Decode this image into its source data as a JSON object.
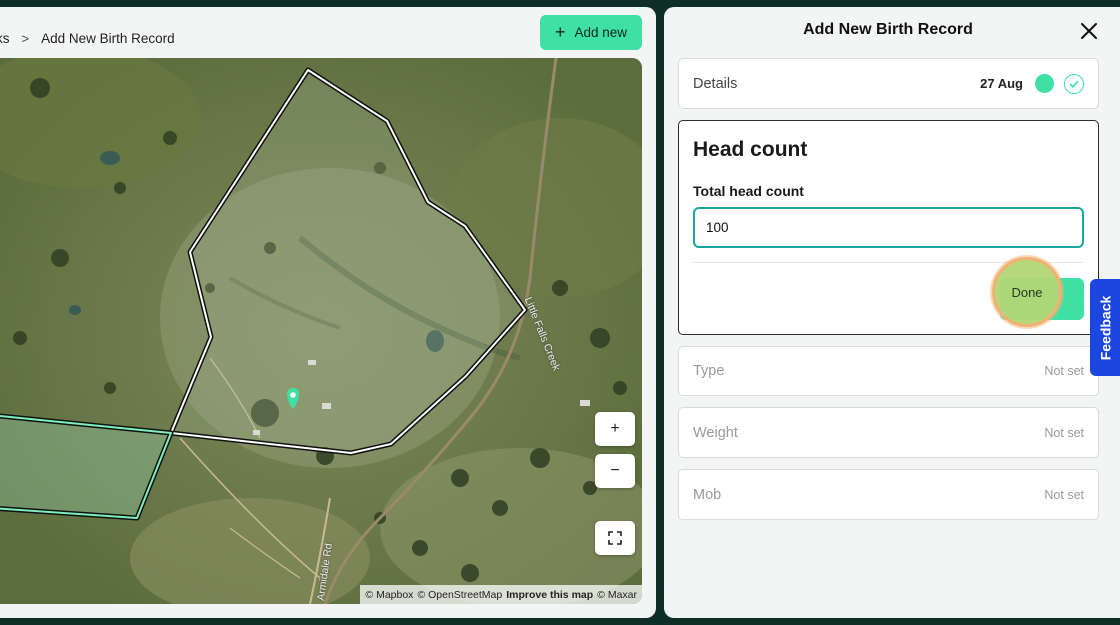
{
  "breadcrumb": {
    "prev_label": "ks",
    "separator": ">",
    "current_label": "Add New Birth Record"
  },
  "toolbar": {
    "add_new_label": "Add new",
    "add_new_icon": "plus-icon"
  },
  "map": {
    "zoom_in_label": "+",
    "zoom_out_label": "−",
    "fullscreen_icon": "expand-icon",
    "marker_icon": "location-pin-icon",
    "road_labels": [
      "Little Falls Creek",
      "Armidale Rd"
    ],
    "attribution": {
      "mapbox": "© Mapbox",
      "osm": "© OpenStreetMap",
      "improve": "Improve this map",
      "maxar": "© Maxar"
    }
  },
  "panel": {
    "title": "Add New Birth Record",
    "close_icon": "close-icon",
    "details": {
      "label": "Details",
      "date": "27 Aug",
      "status_icon": "check-circle-icon"
    },
    "head_count": {
      "title": "Head count",
      "field_label": "Total head count",
      "value": "100",
      "done_label": "Done"
    },
    "rows": [
      {
        "label": "Type",
        "value": "Not set"
      },
      {
        "label": "Weight",
        "value": "Not set"
      },
      {
        "label": "Mob",
        "value": "Not set"
      }
    ]
  },
  "feedback": {
    "label": "Feedback"
  },
  "colors": {
    "accent": "#3ee0a4",
    "input_focus": "#17a7a0",
    "feedback": "#1c46e0",
    "background": "#0f2e26"
  }
}
